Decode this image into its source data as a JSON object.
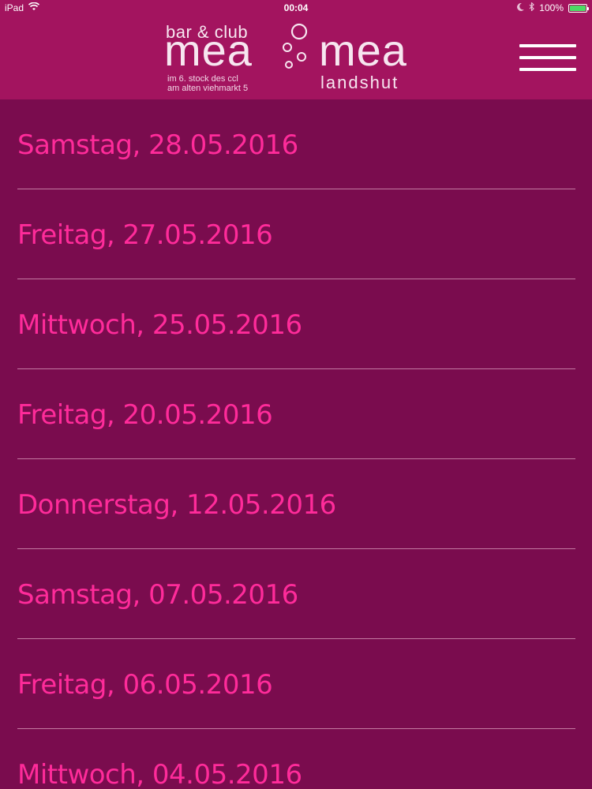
{
  "status_bar": {
    "device": "iPad",
    "time": "00:04",
    "battery": "100%",
    "battery_level": 1.0,
    "wifi_icon": "wifi-icon",
    "moon_icon": "moon-icon",
    "bluetooth_icon": "bluetooth-icon"
  },
  "header": {
    "logo": {
      "bar_club": "bar & club",
      "mea_left": "mea",
      "address_line1": "im 6. stock des ccl",
      "address_line2": "am alten viehmarkt 5",
      "mea_right": "mea",
      "city": "landshut"
    },
    "menu_icon": "hamburger-menu-icon"
  },
  "events": [
    {
      "label": "Samstag, 28.05.2016"
    },
    {
      "label": "Freitag, 27.05.2016"
    },
    {
      "label": "Mittwoch, 25.05.2016"
    },
    {
      "label": "Freitag, 20.05.2016"
    },
    {
      "label": "Donnerstag, 12.05.2016"
    },
    {
      "label": "Samstag, 07.05.2016"
    },
    {
      "label": "Freitag, 06.05.2016"
    },
    {
      "label": "Mittwoch, 04.05.2016"
    }
  ],
  "colors": {
    "background": "#7a0c4e",
    "header": "#a3145f",
    "accent_text": "#ff2b9a",
    "divider": "#c47aa2"
  }
}
